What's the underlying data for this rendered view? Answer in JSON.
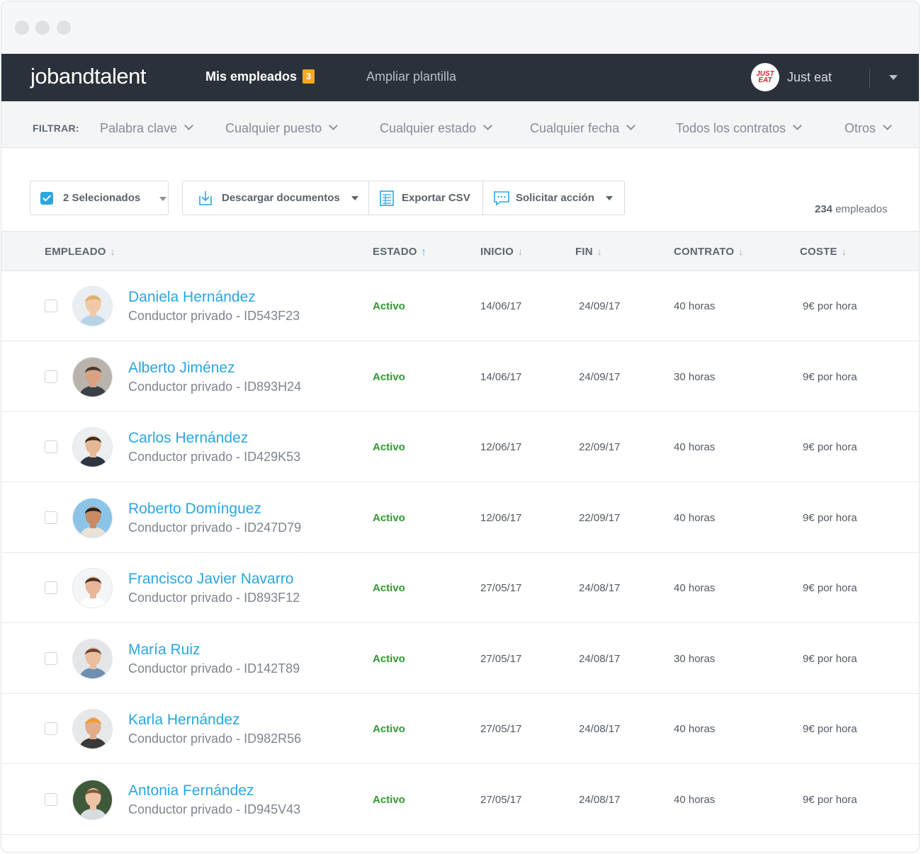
{
  "window": {
    "dots": [
      "close",
      "minimize",
      "maximize"
    ]
  },
  "header": {
    "brand_light": "jobandtalent",
    "nav": [
      {
        "label": "Mis empleados",
        "badge": "3",
        "active": true
      },
      {
        "label": "Ampliar plantilla",
        "active": false
      }
    ],
    "company": {
      "logo_text_1": "JUST",
      "logo_text_2": "EAT",
      "name": "Just eat"
    }
  },
  "filters": {
    "label": "FILTRAR:",
    "items": [
      "Palabra clave",
      "Cualquier puesto",
      "Cualquier estado",
      "Cualquier fecha",
      "Todos los contratos",
      "Otros"
    ]
  },
  "toolbar": {
    "selected_label": "2 Selecionados",
    "download_label": "Descargar documentos",
    "export_label": "Exportar CSV",
    "request_label": "Solicitar acción",
    "total_count": "234",
    "total_suffix": " empleados"
  },
  "table": {
    "columns": [
      {
        "label": "EMPLEADO",
        "sort": "↓"
      },
      {
        "label": "ESTADO",
        "sort": "↑"
      },
      {
        "label": "INICIO",
        "sort": "↓"
      },
      {
        "label": "FIN",
        "sort": "↓"
      },
      {
        "label": "CONTRATO",
        "sort": "↓"
      },
      {
        "label": "COSTE",
        "sort": "↓"
      }
    ],
    "rows": [
      {
        "name": "Daniela Hernández",
        "role": "Conductor privado - ID543F23",
        "status": "Activo",
        "inicio": "14/06/17",
        "fin": "24/09/17",
        "contrato": "40 horas",
        "coste": "9€ por hora",
        "avatar": {
          "bg": "#e9eef2",
          "skin": "#f2c9a6",
          "hair": "#d9b06a",
          "shirt": "#b9d3e6"
        }
      },
      {
        "name": "Alberto Jiménez",
        "role": "Conductor privado - ID893H24",
        "status": "Activo",
        "inicio": "14/06/17",
        "fin": "24/09/17",
        "contrato": "30 horas",
        "coste": "9€ por hora",
        "avatar": {
          "bg": "#b9b3ad",
          "skin": "#d9a383",
          "hair": "#4a3a30",
          "shirt": "#3b3f46"
        }
      },
      {
        "name": "Carlos Hernández",
        "role": "Conductor privado - ID429K53",
        "status": "Activo",
        "inicio": "12/06/17",
        "fin": "22/09/17",
        "contrato": "40 horas",
        "coste": "9€ por hora",
        "avatar": {
          "bg": "#eceff1",
          "skin": "#e7b895",
          "hair": "#3d2b22",
          "shirt": "#2c3440"
        }
      },
      {
        "name": "Roberto Domínguez",
        "role": "Conductor privado - ID247D79",
        "status": "Activo",
        "inicio": "12/06/17",
        "fin": "22/09/17",
        "contrato": "40 horas",
        "coste": "9€ por hora",
        "avatar": {
          "bg": "#8cc4e8",
          "skin": "#c98b63",
          "hair": "#2a2420",
          "shirt": "#e8e2d8"
        }
      },
      {
        "name": "Francisco Javier Navarro",
        "role": "Conductor privado - ID893F12",
        "status": "Activo",
        "inicio": "27/05/17",
        "fin": "24/08/17",
        "contrato": "40 horas",
        "coste": "9€ por hora",
        "avatar": {
          "bg": "#f4f5f6",
          "skin": "#e8b797",
          "hair": "#4a3326",
          "shirt": "#ffffff"
        }
      },
      {
        "name": "María Ruiz",
        "role": "Conductor privado - ID142T89",
        "status": "Activo",
        "inicio": "27/05/17",
        "fin": "24/08/17",
        "contrato": "30 horas",
        "coste": "9€ por hora",
        "avatar": {
          "bg": "#e3e6e9",
          "skin": "#ebbd9c",
          "hair": "#6b4530",
          "shirt": "#6f8fb0"
        }
      },
      {
        "name": "Karla Hernández",
        "role": "Conductor privado - ID982R56",
        "status": "Activo",
        "inicio": "27/05/17",
        "fin": "24/08/17",
        "contrato": "40 horas",
        "coste": "9€ por hora",
        "avatar": {
          "bg": "#e6e8ea",
          "skin": "#e2ad8a",
          "hair": "#f29a2e",
          "shirt": "#3a3a3a"
        }
      },
      {
        "name": "Antonia Fernández",
        "role": "Conductor privado - ID945V43",
        "status": "Activo",
        "inicio": "27/05/17",
        "fin": "24/08/17",
        "contrato": "40 horas",
        "coste": "9€ por hora",
        "avatar": {
          "bg": "#3f5a3a",
          "skin": "#efc4a6",
          "hair": "#8a5a36",
          "shirt": "#d8dde2"
        }
      }
    ]
  },
  "colors": {
    "accent": "#2ba6e0",
    "status_active": "#2f9a2f",
    "appbar": "#2b313a",
    "badge": "#f7a823"
  }
}
